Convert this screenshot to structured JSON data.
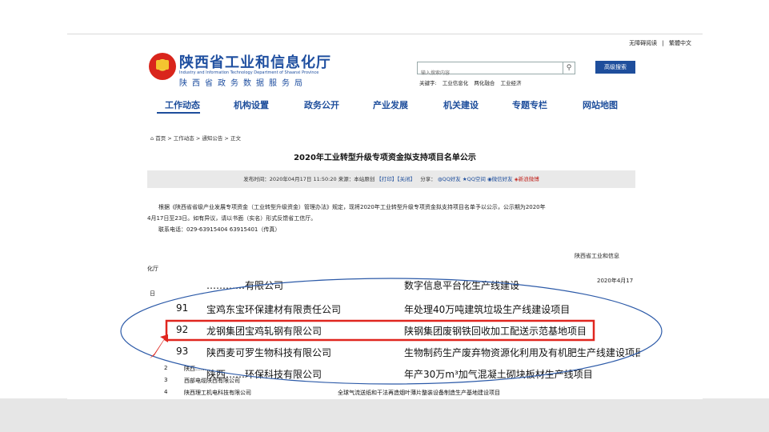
{
  "top_links": [
    "无障碍阅读",
    "|",
    "繁體中文"
  ],
  "brand": {
    "name_cn": "陕西省工业和信息化厅",
    "name_en": "Industry and Information Technology Department of Shaanxi Province",
    "subtitle": "陕西省政务数据服务局"
  },
  "search": {
    "placeholder": "输入搜索内容",
    "button": "高级搜索",
    "keywords_label": "关键字:",
    "keywords": [
      "工业信息化",
      "两化融合",
      "工业经济"
    ]
  },
  "nav": [
    "工作动态",
    "机构设置",
    "政务公开",
    "产业发展",
    "机关建设",
    "专题专栏",
    "网站地图"
  ],
  "breadcrumb": "首页 > 工作动态 > 通知公告 > 正文",
  "doc": {
    "title": "2020年工业转型升级专项资金拟支持项目名单公示",
    "meta_time": "发布时间：2020年04月17日 11:50:20",
    "meta_source": "来源：本站原创",
    "print": "【打印】",
    "close": "【关闭】",
    "share_label": "分享：",
    "share": [
      "QQ好友",
      "QQ空间",
      "微信好友",
      "新浪微博"
    ],
    "para1": "根据《陕西省省级产业发展专项资金（工业转型升级资金）管理办法》规定，现将2020年工业转型升级专项资金拟支持项目名单予以公示，公示期为2020年",
    "para2": "4月17日至23日。如有异议，请以书面（实名）形式反馈省工信厅。",
    "contact": "联系电话：029-63915404    63915401（传真）",
    "sig_org_a": "陕西省工业和信息",
    "sig_org_b": "化厅",
    "sig_date": "2020年4月17",
    "sig_tail": "日"
  },
  "table_rows": [
    {
      "num": "",
      "company": "…………有限公司",
      "project": "数字信息平台化生产线建设"
    },
    {
      "num": "91",
      "company": "宝鸡东宝环保建材有限责任公司",
      "project": "年处理40万吨建筑垃圾生产线建设项目"
    },
    {
      "num": "92",
      "company": "龙钢集团宝鸡轧钢有限公司",
      "project": "陕钢集团废钢铁回收加工配送示范基地项目"
    },
    {
      "num": "93",
      "company": "陕西麦可罗生物科技有限公司",
      "project": "生物制药生产废弃物资源化利用及有机肥生产线建设项目"
    },
    {
      "num": "",
      "company": "陕西……环保科技有限公司",
      "project": "年产30万m³加气混凝土砌块板材生产线项目"
    }
  ],
  "table_rows_small": [
    {
      "num": "2",
      "company": "陕西……",
      "project": ""
    },
    {
      "num": "3",
      "company": "西部电缆陕西有限公司",
      "project": ""
    },
    {
      "num": "4",
      "company": "陕西理工机电科技有限公司",
      "project": "全球气流送纸和干法再造烟叶薄片整装设备制造生产基地建设项目"
    }
  ],
  "colors": {
    "brand_blue": "#1e4e9c",
    "highlight_red": "#e0261f",
    "ellipse_blue": "#2c5aa8"
  }
}
